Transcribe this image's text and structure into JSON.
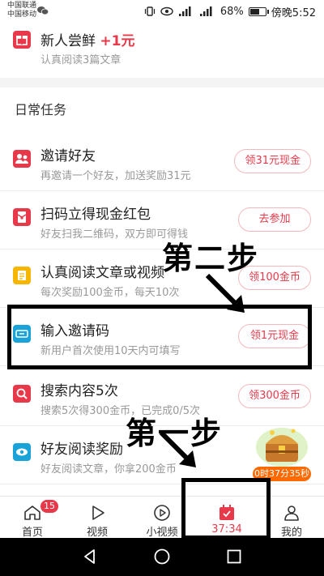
{
  "status_bar": {
    "carrier1": "中国联通",
    "carrier2": "中国移动",
    "battery_percent": "68%",
    "battery_level": 0.68,
    "time": "傍晚5:52"
  },
  "tasks_top": {
    "newbie": {
      "title": "新人尝鲜",
      "bonus": "+1元",
      "subtitle": "认真阅读3篇文章"
    }
  },
  "section_title": "日常任务",
  "tasks": [
    {
      "title": "邀请好友",
      "subtitle": "再邀请一个好友，加送奖励31元",
      "button": "领31元现金"
    },
    {
      "title": "扫码立得现金红包",
      "subtitle": "好友扫我二维码，双方即可得钱",
      "button": "去参加"
    },
    {
      "title": "认真阅读文章或视频",
      "subtitle": "每次奖励100金币，每天10次",
      "button": "领100金币"
    },
    {
      "title": "输入邀请码",
      "subtitle": "新用户首次使用10天内可填写",
      "button": "领1元现金"
    },
    {
      "title": "搜索内容5次",
      "subtitle": "搜索5次得300金币，已完成0/5次",
      "button": "领300金币"
    },
    {
      "title": "好友阅读奖励",
      "subtitle": "好友阅读文章，你拿200金币"
    }
  ],
  "annotations": {
    "step2": "第二步",
    "step1": "第一步"
  },
  "treasure_timer": "0时37分35秒",
  "tabbar": {
    "tabs": [
      {
        "label": "首页",
        "icon": "home-icon",
        "badge": "15"
      },
      {
        "label": "视频",
        "icon": "play-icon"
      },
      {
        "label": "小视频",
        "icon": "small-video-icon"
      },
      {
        "label": "37:34",
        "icon": "task-calendar-icon",
        "active": true
      },
      {
        "label": "我的",
        "icon": "profile-icon"
      }
    ]
  },
  "colors": {
    "accent": "#e8394a",
    "timer": "#ff6a00",
    "nav": "#000000"
  }
}
